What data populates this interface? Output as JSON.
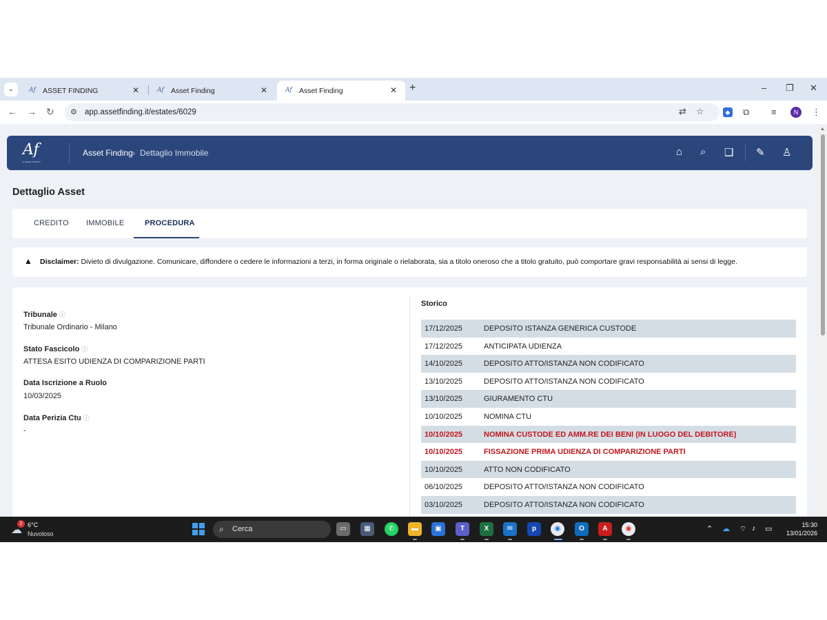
{
  "browser": {
    "tabs": [
      {
        "title": "ASSET FINDING",
        "favicon": "af-favicon"
      },
      {
        "title": "Asset Finding",
        "favicon": "af-favicon"
      },
      {
        "title": "Asset Finding",
        "favicon": "af-favicon",
        "active": true
      }
    ],
    "url": "app.assetfinding.it/estates/6029",
    "profile_initial": "N"
  },
  "header": {
    "logo": "Af",
    "logo_sub": "by ASSET FINDING",
    "breadcrumb_root": "Asset Finding",
    "breadcrumb_sep": "›",
    "breadcrumb_current": "Dettaglio Immobile",
    "accent": "#2b467b"
  },
  "page": {
    "title": "Dettaglio Asset",
    "tabs": [
      "CREDITO",
      "IMMOBILE",
      "PROCEDURA"
    ],
    "active_tab": "PROCEDURA"
  },
  "disclaimer": {
    "label": "Disclaimer:",
    "text": " Divieto di divulgazione. Comunicare, diffondere o cedere le informazioni a terzi, in forma originale o rielaborata, sia a titolo oneroso che a titolo gratuito, può comportare gravi responsabilità ai sensi di legge."
  },
  "details": {
    "tribunale": {
      "label": "Tribunale",
      "value": "Tribunale Ordinario - Milano"
    },
    "stato": {
      "label": "Stato Fascicolo",
      "value": "ATTESA ESITO UDIENZA DI COMPARIZIONE PARTI"
    },
    "iscrizione": {
      "label": "Data Iscrizione a Ruolo",
      "value": "10/03/2025"
    },
    "perizia": {
      "label": "Data Perizia Ctu",
      "value": "-"
    }
  },
  "storico": {
    "title": "Storico",
    "highlight_color": "#c5161d",
    "rows": [
      {
        "date": "17/12/2025",
        "event": "DEPOSITO ISTANZA GENERICA CUSTODE"
      },
      {
        "date": "17/12/2025",
        "event": "ANTICIPATA UDIENZA"
      },
      {
        "date": "14/10/2025",
        "event": "DEPOSITO ATTO/ISTANZA NON CODIFICATO"
      },
      {
        "date": "13/10/2025",
        "event": "DEPOSITO ATTO/ISTANZA NON CODIFICATO"
      },
      {
        "date": "13/10/2025",
        "event": "GIURAMENTO CTU"
      },
      {
        "date": "10/10/2025",
        "event": "NOMINA CTU"
      },
      {
        "date": "10/10/2025",
        "event": "NOMINA CUSTODE ED AMM.RE DEI BENI (IN LUOGO DEL DEBITORE)",
        "highlight": true
      },
      {
        "date": "10/10/2025",
        "event": "FISSAZIONE PRIMA UDIENZA DI COMPARIZIONE PARTI",
        "highlight": true
      },
      {
        "date": "10/10/2025",
        "event": "ATTO NON CODIFICATO"
      },
      {
        "date": "06/10/2025",
        "event": "DEPOSITO ATTO/ISTANZA NON CODIFICATO"
      },
      {
        "date": "03/10/2025",
        "event": "DEPOSITO ATTO/ISTANZA NON CODIFICATO"
      }
    ]
  },
  "taskbar": {
    "weather_temp": "6°C",
    "weather_cond": "Nuvoloso",
    "weather_badge": "2",
    "search_label": "Cerca",
    "time": "15:30",
    "date": "13/01/2026",
    "apps": [
      "task-view",
      "calculator",
      "whatsapp",
      "file-explorer",
      "remote-desktop",
      "teams",
      "excel",
      "mail",
      "p-app",
      "chrome",
      "outlook",
      "acrobat",
      "chrome-profile"
    ]
  }
}
